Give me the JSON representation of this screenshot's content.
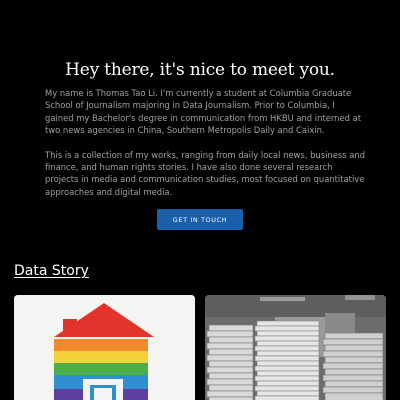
{
  "hero": {
    "headline_highlight": "Hey there,",
    "headline_rest": " it's nice to meet you.",
    "intro_paragraph_1": "My name is Thomas Tao Li. I'm currently a student at Columbia Graduate School of Journalism majoring in Data Journalism. Prior to Columbia, I gained my Bachelor's degree in communication from HKBU and interned at two news agencies in China, Southern Metropolis Daily and Caixin.",
    "intro_paragraph_2": "This is a collection of my works, ranging from daily local news, business and finance, and human rights stories. I have also done several research projects in media and communication studies, most focused on quantitative approaches and digital media.",
    "cta_label": "GET IN TOUCH"
  },
  "section": {
    "title": "Data Story"
  },
  "cards": [
    {
      "image": "rainbow-house-illustration"
    },
    {
      "image": "stacked-paper-files-photo"
    }
  ],
  "colors": {
    "background": "#000000",
    "accent": "#1b5fab",
    "text_primary": "#ffffff",
    "text_secondary": "#a0a0a0"
  }
}
